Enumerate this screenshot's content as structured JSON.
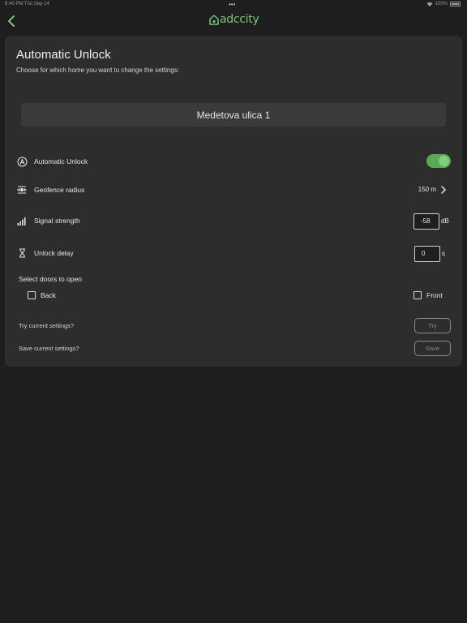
{
  "status_bar": {
    "time_date": "8:40 PM  Thu Sep 14",
    "battery": "100%",
    "more_dots": "•••"
  },
  "nav": {
    "logo_text": "adccity"
  },
  "header": {
    "title": "Automatic Unlock",
    "subtitle": "Choose for which home you want to change the settings:"
  },
  "home": {
    "selected": "Medetova ulica 1"
  },
  "settings": {
    "auto_unlock": {
      "label": "Automatic Unlock",
      "enabled": true
    },
    "geofence": {
      "label": "Geofence radius",
      "value": "150 m"
    },
    "signal": {
      "label": "Signal strength",
      "value": "-58",
      "unit": "dB"
    },
    "delay": {
      "label": "Unlock delay",
      "value": "0",
      "unit": "s"
    }
  },
  "doors": {
    "label": "Select doors to open",
    "items": [
      {
        "label": "Back",
        "checked": false
      },
      {
        "label": "Front",
        "checked": false
      }
    ]
  },
  "actions": {
    "try_prompt": "Try current settings?",
    "try_label": "Try",
    "save_prompt": "Save current settings?",
    "save_label": "Save"
  },
  "colors": {
    "accent": "#5ba85a",
    "card": "#2d2d2d",
    "background": "#1e1e1e"
  }
}
